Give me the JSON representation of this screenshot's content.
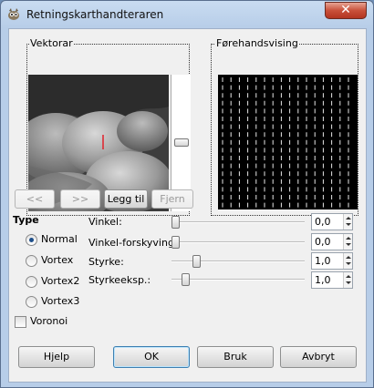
{
  "window": {
    "title": "Retningskarthandteraren"
  },
  "vectors": {
    "label": "Vektorar"
  },
  "preview": {
    "label": "Førehandsvising"
  },
  "vector_buttons": {
    "prev": "<<",
    "next": ">>",
    "add": "Legg til",
    "remove": "Fjern"
  },
  "type": {
    "title": "Type",
    "options": [
      "Normal",
      "Vortex",
      "Vortex2",
      "Vortex3"
    ],
    "selected": "Normal"
  },
  "voronoi": {
    "label": "Voronoi",
    "checked": false
  },
  "params": [
    {
      "label": "Vinkel:",
      "value": "0,0"
    },
    {
      "label": "Vinkel-forskyving:",
      "value": "0,0"
    },
    {
      "label": "Styrke:",
      "value": "1,0"
    },
    {
      "label": "Styrkeeksp.:",
      "value": "1,0"
    }
  ],
  "slider_levels": [
    0.0,
    0.0,
    0.17,
    0.08
  ],
  "buttons": {
    "help": "Hjelp",
    "ok": "OK",
    "apply": "Bruk",
    "cancel": "Avbryt"
  },
  "colors": {
    "vector_mark": "#e0202a",
    "preview_bg": "#000000",
    "accent": "#3c7fb1"
  },
  "icons": {
    "app": "gimp-icon",
    "close": "close-icon"
  }
}
